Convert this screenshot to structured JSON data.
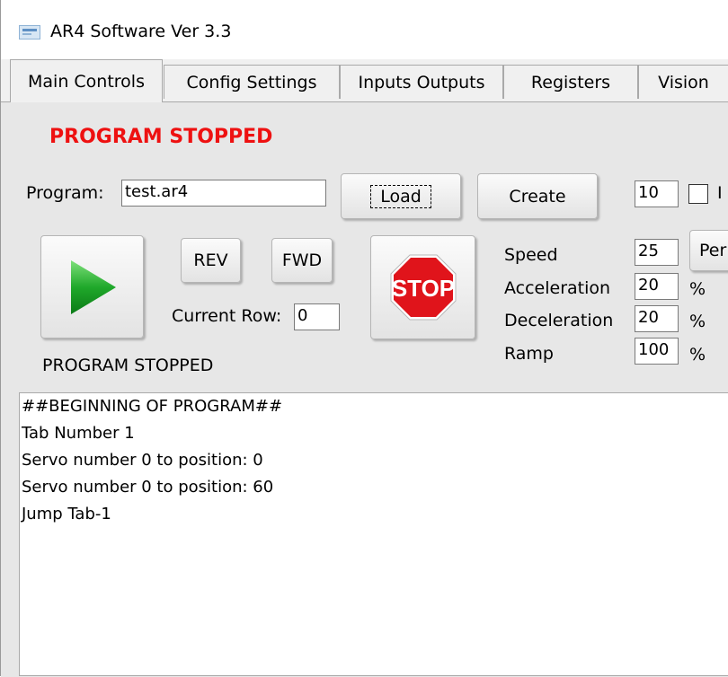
{
  "window": {
    "title": "AR4 Software Ver 3.3",
    "icon": "app-icon"
  },
  "tabs": [
    {
      "label": "Main Controls",
      "active": true
    },
    {
      "label": "Config Settings",
      "active": false
    },
    {
      "label": "Inputs Outputs",
      "active": false
    },
    {
      "label": "Registers",
      "active": false
    },
    {
      "label": "Vision",
      "active": false
    }
  ],
  "status": {
    "header": "PROGRAM STOPPED",
    "footer": "PROGRAM STOPPED",
    "header_color": "#ee1111"
  },
  "program": {
    "label": "Program:",
    "value": "test.ar4",
    "load_label": "Load",
    "create_label": "Create",
    "count_value": "10",
    "checkbox_label": "I"
  },
  "controls": {
    "play_icon": "play-icon",
    "rev_label": "REV",
    "fwd_label": "FWD",
    "stop_icon": "stop-sign-icon",
    "stop_text": "STOP",
    "current_row_label": "Current Row:",
    "current_row_value": "0"
  },
  "motion": {
    "speed_label": "Speed",
    "speed_value": "25",
    "speed_unit_button": "Per",
    "acceleration_label": "Acceleration",
    "acceleration_value": "20",
    "deceleration_label": "Deceleration",
    "deceleration_value": "20",
    "ramp_label": "Ramp",
    "ramp_value": "100",
    "percent": "%"
  },
  "console": {
    "lines": [
      "##BEGINNING OF PROGRAM##",
      "Tab Number 1",
      "Servo number 0 to position: 0",
      "Servo number 0 to position: 60",
      "Jump Tab-1"
    ]
  }
}
